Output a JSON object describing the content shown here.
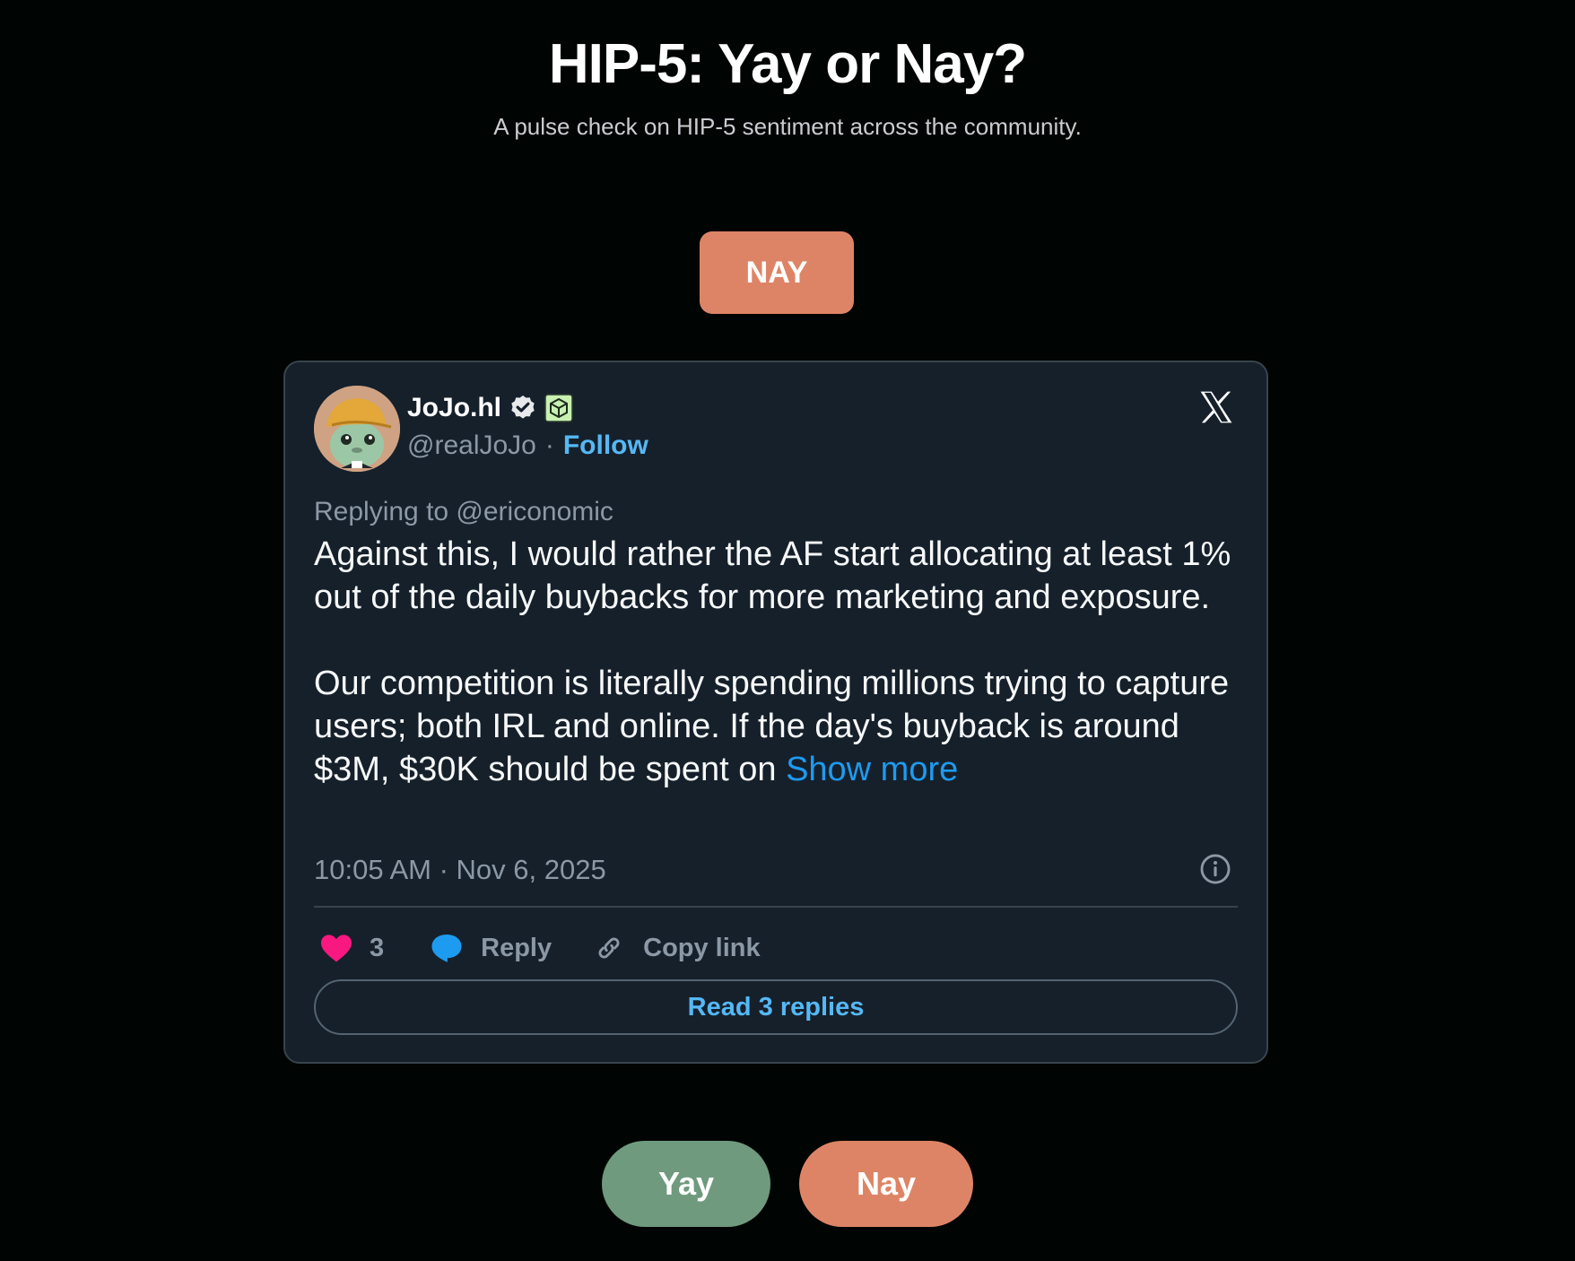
{
  "header": {
    "title": "HIP-5: Yay or Nay?",
    "subtitle": "A pulse check on HIP-5 sentiment across the community."
  },
  "verdict": {
    "label": "NAY",
    "color": "#de8466"
  },
  "tweet": {
    "author": {
      "name": "JoJo.hl",
      "handle": "@realJoJo",
      "separator": "·",
      "follow_label": "Follow",
      "verified": true,
      "affiliate_icon": "green-cube-badge-icon"
    },
    "platform_icon": "x-logo-icon",
    "reply_context": "Replying to @ericonomic",
    "paragraphs": [
      "Against this, I would rather the AF start allocating at least 1% out of the daily buybacks for more marketing and exposure.",
      "Our competition is literally spending millions trying to capture users; both IRL and online. If the day's buyback is around $3M, $30K should be spent on"
    ],
    "show_more_label": "Show more",
    "timestamp": "10:05 AM · Nov 6, 2025",
    "actions": {
      "like_count": "3",
      "reply_label": "Reply",
      "copy_link_label": "Copy link"
    },
    "read_replies_label": "Read 3 replies"
  },
  "vote": {
    "yay_label": "Yay",
    "nay_label": "Nay",
    "yay_color": "#6f9a7e",
    "nay_color": "#de8466"
  },
  "colors": {
    "background": "#000402",
    "card": "#16202b",
    "link": "#1d9bf0",
    "like": "#f91880"
  }
}
